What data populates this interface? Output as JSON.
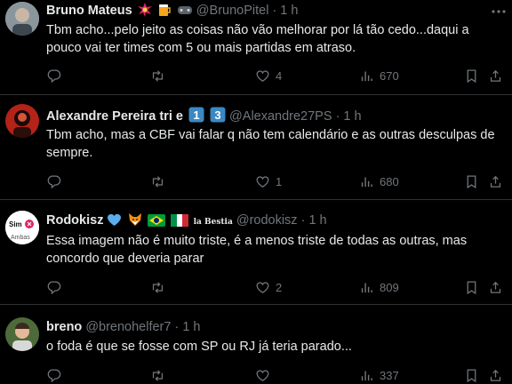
{
  "tweets": [
    {
      "name": "Bruno Mateus",
      "handle": "@BrunoPitel",
      "time": "· 1 h",
      "text": "Tbm acho...pelo jeito as coisas não vão melhorar por lá tão cedo...daqui a pouco vai ter times com 5 ou mais partidas em atraso.",
      "replies": "",
      "retweets": "",
      "likes": "4",
      "views": "670",
      "badges": [
        "explosion-icon",
        "beer-icon",
        "gamepad-icon"
      ]
    },
    {
      "name": "Alexandre Pereira tri e",
      "handle": "@Alexandre27PS",
      "time": "· 1 h",
      "text": "Tbm acho, mas a CBF vai falar q não tem calendário e as outras desculpas de sempre.",
      "replies": "",
      "retweets": "",
      "likes": "1",
      "views": "680",
      "badges": [
        "keycap-1",
        "keycap-3"
      ],
      "keycaps": [
        "1",
        "3"
      ]
    },
    {
      "name": "Rodokisz",
      "handle": "@rodokisz",
      "time": "· 1 h",
      "text": "Essa imagem não é muito triste, é a menos triste de todas as outras, mas concordo que deveria parar",
      "replies": "",
      "retweets": "",
      "likes": "2",
      "views": "809",
      "badges": [
        "blue-heart-icon",
        "fox-icon",
        "brazil-flag-icon",
        "italy-flag-icon"
      ],
      "extra_badge": "la Bestia",
      "avatar_text_top": "Sim",
      "avatar_text_bottom": "Ambas"
    },
    {
      "name": "breno",
      "handle": "@brenohelfer7",
      "time": "· 1 h",
      "text": "o foda é que se fosse com SP ou RJ já teria parado...",
      "replies": "",
      "retweets": "",
      "likes": "",
      "views": "337"
    }
  ],
  "colors": {
    "background": "#000000",
    "text": "#e7e9ea",
    "muted": "#71767b",
    "divider": "#2f3336",
    "keycap": "#3b88c3"
  }
}
